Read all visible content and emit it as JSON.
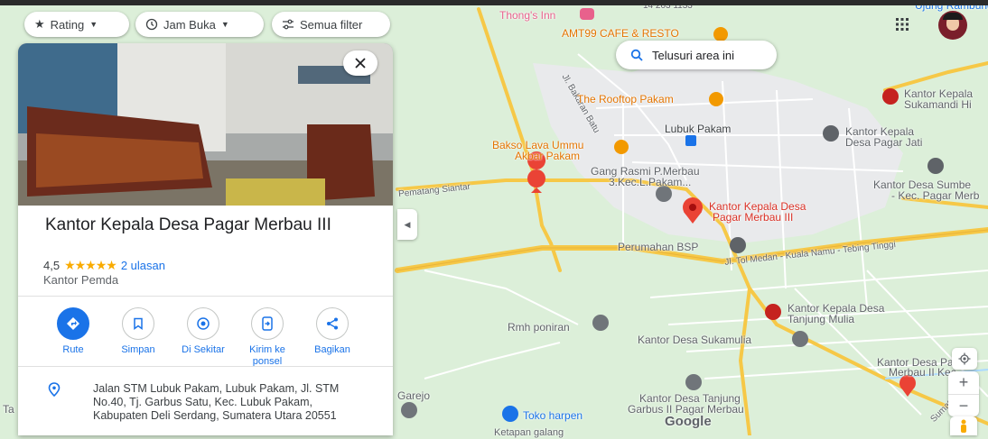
{
  "filters": {
    "rating": "Rating",
    "hours": "Jam Buka",
    "all_filters": "Semua filter"
  },
  "search_area": "Telusuri area ini",
  "place": {
    "name": "Kantor Kepala Desa Pagar Merbau III",
    "rating": "4,5",
    "stars": "★★★★★",
    "reviews": "2 ulasan",
    "category": "Kantor Pemda",
    "address": "Jalan STM Lubuk Pakam, Lubuk Pakam, Jl. STM No.40, Tj. Garbus Satu, Kec. Lubuk Pakam, Kabupaten Deli Serdang, Sumatera Utara 20551"
  },
  "actions": {
    "route": "Rute",
    "save": "Simpan",
    "nearby": "Di Sekitar",
    "send_line1": "Kirim ke",
    "send_line2": "ponsel",
    "share": "Bagikan"
  },
  "map": {
    "labels": {
      "top_road_number": "14 203 1133",
      "ujung_rambung": "Ujung Rambung",
      "thongs_inn": "Thong's Inn",
      "amt99": "AMT99 CAFE & RESTO",
      "jl_bakaran": "Jl. Bakaran Batu",
      "rooftop": "The Rooftop Pakam",
      "kk_sukamandi_1": "Kantor Kepala",
      "kk_sukamandi_2": "Sukamandi Hi",
      "lubuk_pakam": "Lubuk Pakam",
      "kk_pagar_jati_1": "Kantor Kepala",
      "kk_pagar_jati_2": "Desa Pagar Jati",
      "bakso_1": "Bakso Lava Ummu",
      "bakso_2": "Akbar Pakam",
      "gang_1": "Gang Rasmi P.Merbau",
      "gang_2": "3.Kec.L.Pakam...",
      "pematang": "Pematang Siantar",
      "kd_sumbe_1": "Kantor Desa Sumbe",
      "kd_sumbe_2": "- Kec. Pagar Merb",
      "selected_1": "Kantor Kepala Desa",
      "selected_2": "Pagar Merbau III",
      "perumahan": "Perumahan BSP",
      "tol": "Jl. Tol Medan - Kuala Namu - Tebing Tinggi",
      "kk_tanjung_1": "Kantor Kepala Desa",
      "kk_tanjung_2": "Tanjung Mulia",
      "rmh": "Rmh poniran",
      "kd_sukamulia": "Kantor Desa Sukamulia",
      "kd_pagar2_1": "Kantor Desa Pa",
      "kd_pagar2_2": "Merbau II Kec.",
      "garejo": "Garejo",
      "kd_tanjung_1": "Kantor Desa Tanjung",
      "kd_tanjung_2": "Garbus II Pagar Merbau",
      "toko": "Toko harpen",
      "google": "Google",
      "sumatera": "Sumatera",
      "ketapan": "Ketapan galang",
      "left_edge_1": "Ta"
    }
  },
  "colors": {
    "map_green": "#dcefd9",
    "road_yellow": "#f6c847",
    "urban_gray": "#e9eaec",
    "accent_blue": "#1a73e8",
    "pin_red": "#ea4335",
    "food_orange": "#f29900",
    "gov_red": "#c5221f"
  }
}
